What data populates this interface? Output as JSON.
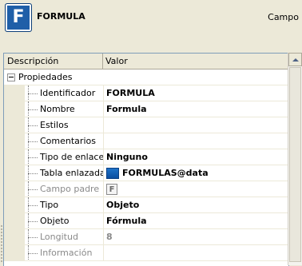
{
  "header": {
    "icon_letter": "F",
    "title": "FORMULA",
    "right_label": "Campo"
  },
  "grid": {
    "columns": [
      "Descripción",
      "Valor"
    ],
    "group_label": "Propiedades",
    "rows": [
      {
        "name": "Identificador",
        "value": "FORMULA",
        "disabled": false
      },
      {
        "name": "Nombre",
        "value": "Formula",
        "disabled": false
      },
      {
        "name": "Estilos",
        "value": "",
        "disabled": false
      },
      {
        "name": "Comentarios",
        "value": "",
        "disabled": false
      },
      {
        "name": "Tipo de enlace",
        "value": "Ninguno",
        "disabled": false
      },
      {
        "name": "Tabla enlazada",
        "value": "FORMULAS@data",
        "disabled": false,
        "icon": "table-icon"
      },
      {
        "name": "Campo padre",
        "value": "",
        "disabled": true,
        "icon": "f-icon",
        "icon_letter": "F"
      },
      {
        "name": "Tipo",
        "value": "Objeto",
        "disabled": false
      },
      {
        "name": "Objeto",
        "value": "Fórmula",
        "disabled": false
      },
      {
        "name": "Longitud",
        "value": "8",
        "disabled": true
      },
      {
        "name": "Información",
        "value": "",
        "disabled": true
      }
    ]
  },
  "colors": {
    "panel_bg": "#ece9d8",
    "icon_blue": "#1f5fa8",
    "border": "#7f9db9"
  }
}
